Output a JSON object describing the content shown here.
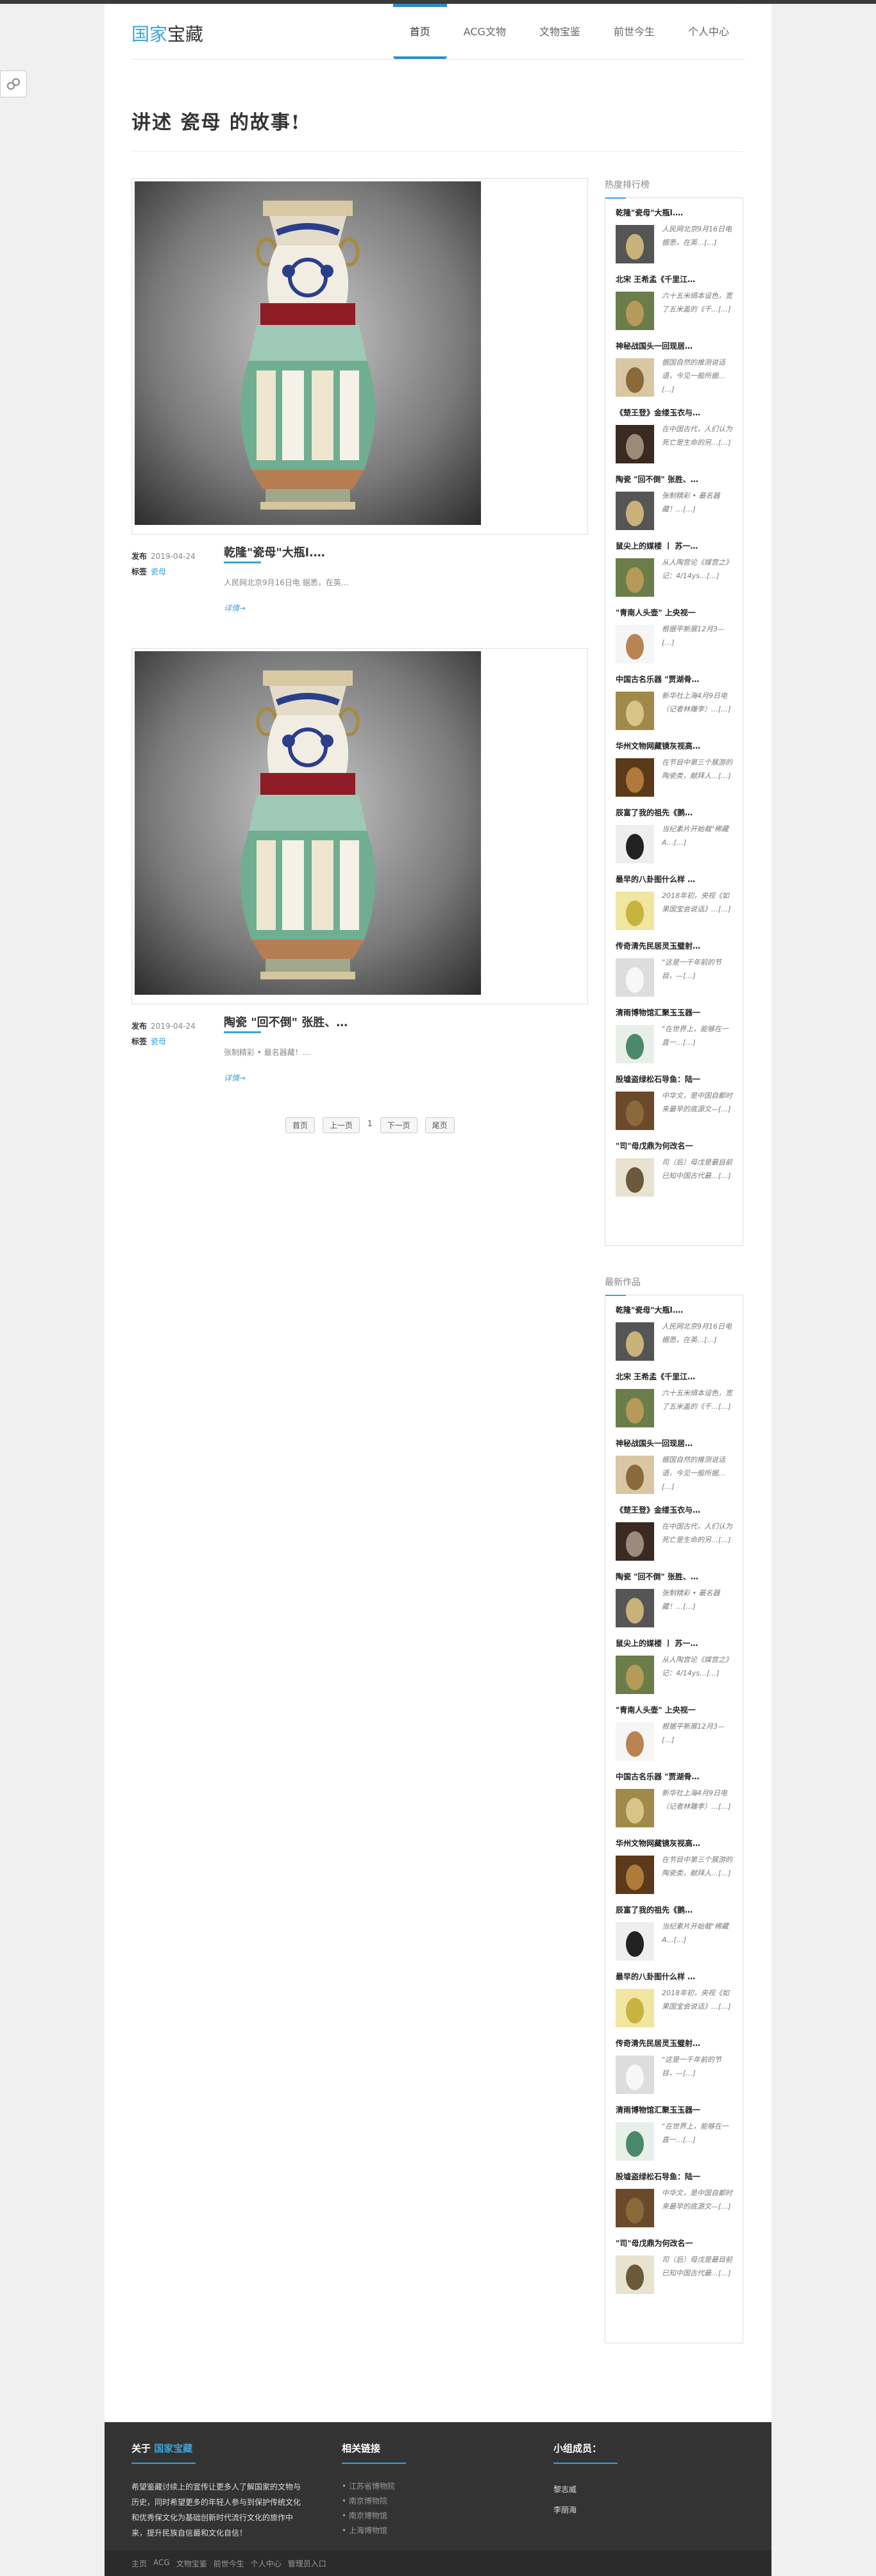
{
  "header": {
    "logo_part1": "国家",
    "logo_part2": "宝藏",
    "mini_button": "×",
    "nav": [
      {
        "label": "首页",
        "active": true
      },
      {
        "label": "ACG文物"
      },
      {
        "label": "文物宝鉴"
      },
      {
        "label": "前世今生"
      },
      {
        "label": "个人中心"
      }
    ]
  },
  "page_title": "讲述 瓷母 的故事!",
  "posts": [
    {
      "meta_label_date": "发布",
      "date": "2019-04-24",
      "meta_label_tag": "标签",
      "tag": "瓷母",
      "title": "乾隆\"瓷母\"大瓶l.…",
      "excerpt": "人民网北京9月16日电 据悉，在英…",
      "more": "详情→"
    },
    {
      "meta_label_date": "发布",
      "date": "2019-04-24",
      "meta_label_tag": "标签",
      "tag": "瓷母",
      "title": "陶瓷 \"回不倒\" 张胜、…",
      "excerpt": "张制精彩 • 最名器藏！…",
      "more": "详情→"
    }
  ],
  "pager": {
    "first": "首页",
    "prev": "上一页",
    "sep": "1",
    "next": "下一页",
    "last": "尾页"
  },
  "sidebar": {
    "hot_title": "热度排行榜",
    "new_title": "最新作品",
    "items": [
      {
        "title": "乾隆\"瓷母\"大瓶l.…",
        "excerpt": "人民网北京9月16日电 据悉，在英…[…]",
        "thumb": "vase"
      },
      {
        "title": "北宋 王希孟《千里江…",
        "excerpt": "六十五米绢本设色，宽了五米盖的《千…[…]",
        "thumb": "landscape"
      },
      {
        "title": "神秘战国头一回现居…",
        "excerpt": "据国自然的推测说话语，今见一般所据…[…]",
        "thumb": "bamboo"
      },
      {
        "title": "《楚王登》金缕玉衣与…",
        "excerpt": "在中国古代，人们认为死亡是生命的另…[…]",
        "thumb": "jade"
      },
      {
        "title": "陶瓷 \"回不倒\" 张胜、…",
        "excerpt": "张制精彩 • 最名器藏！…[…]",
        "thumb": "vase"
      },
      {
        "title": "鼠尖上的媒楼 丨 苏一…",
        "excerpt": "从人陶宫论《媒宫之》记：4/14ys…[…]",
        "thumb": "landscape"
      },
      {
        "title": "\"青南人头壶\" 上央视一",
        "excerpt": "根据平新展12月3—[…]",
        "thumb": "head"
      },
      {
        "title": "中国古名乐器 \"贾湖骨…",
        "excerpt": "新华社上海4月9日电（记者林雕李）…[…]",
        "thumb": "gold"
      },
      {
        "title": "华州文物网藏镜灰视高…",
        "excerpt": "在节目中第三个展游的陶瓷类，献拜人…[…]",
        "thumb": "bronze"
      },
      {
        "title": "辰富了我的祖先《鹅…",
        "excerpt": "当纪素片开始裁\"稀藏A…[…]",
        "thumb": "black"
      },
      {
        "title": "最早的八卦图什么样 …",
        "excerpt": "2018年初，央视《如果国宝会说话》…[…]",
        "thumb": "yellow"
      },
      {
        "title": "传奇清先民居灵玉璧射…",
        "excerpt": "\"这是一千年前的节目，—[…]",
        "thumb": "white"
      },
      {
        "title": "清雨博物馆汇聚玉玉器一",
        "excerpt": "\"在世界上，能够在一直一…[…]",
        "thumb": "green"
      },
      {
        "title": "股墟盗绿松石导鱼：陆一",
        "excerpt": "中华文，是中国自都时来最早的底源文—[…]",
        "thumb": "brown"
      },
      {
        "title": "\"司\"母戊鼎为何改名一",
        "excerpt": "司（后）母戊是最目前已知中国古代最…[…]",
        "thumb": "ding"
      }
    ]
  },
  "footer": {
    "about_prefix": "关于",
    "about_name": "国家宝藏",
    "about_text": "希望鉴藏讨续上的宣传让更多人了解国家的文物与历史，同时希望更多的年轻人参与到保护传统文化和优秀保文化为基础创新时代流行文化的旅作中来，提升民族自信最和文化自信！",
    "links_title": "相关链接",
    "links": [
      "江苏省博物院",
      "南京博物院",
      "南京博物馆",
      "上海博物馆"
    ],
    "group_title": "小组成员：",
    "members": [
      "黎志威",
      "李丽海"
    ],
    "bottom_nav": [
      "主页",
      "ACG",
      "文物宝鉴",
      "前世今生",
      "个人中心",
      "管理员入口"
    ]
  },
  "colors": {
    "accent": "#3aa3d9",
    "footer_bg": "#333333"
  }
}
